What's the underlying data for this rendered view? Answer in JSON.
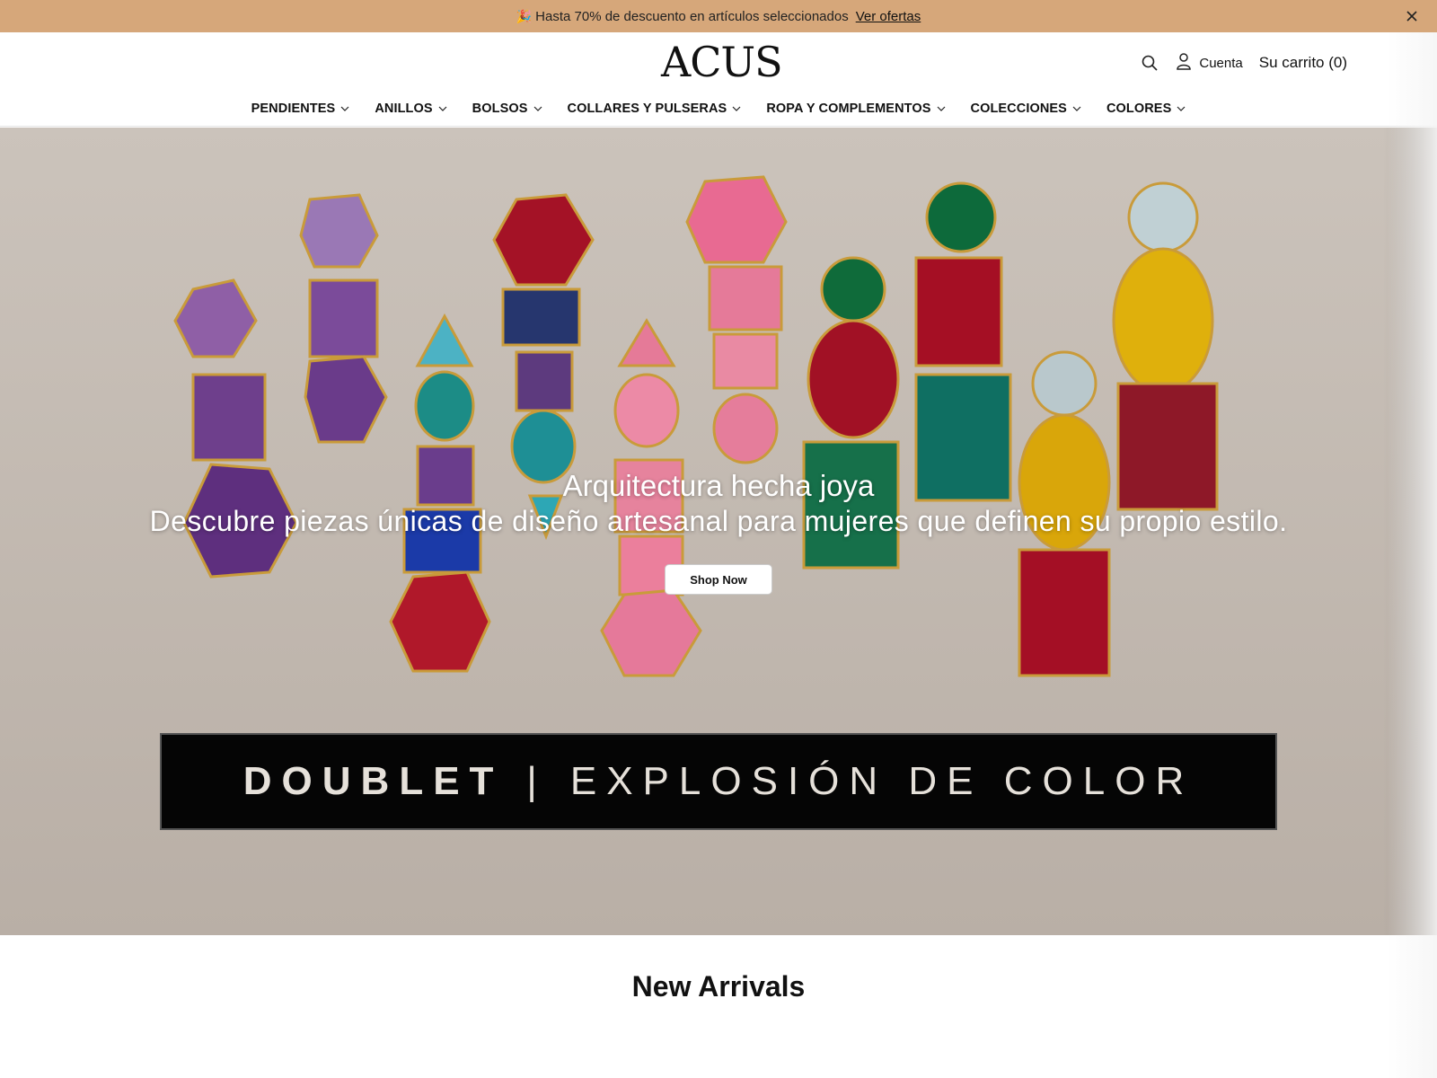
{
  "announcement": {
    "emoji": "🎉",
    "text": "Hasta 70% de descuento en artículos seleccionados",
    "link_label": "Ver ofertas",
    "background": "#d6a77a"
  },
  "header": {
    "logo": "ACUS",
    "account_label": "Cuenta",
    "cart_label": "Su carrito (0)"
  },
  "nav": {
    "items": [
      {
        "label": "PENDIENTES"
      },
      {
        "label": "ANILLOS"
      },
      {
        "label": "BOLSOS"
      },
      {
        "label": "COLLARES Y PULSERAS"
      },
      {
        "label": "ROPA Y COMPLEMENTOS"
      },
      {
        "label": "COLECCIONES"
      },
      {
        "label": "COLORES"
      }
    ]
  },
  "hero": {
    "title": "Arquitectura hecha joya",
    "subtitle": "Descubre piezas únicas de diseño artesanal para mujeres que definen su propio estilo.",
    "button_label": "Shop Now",
    "banner_strong": "DOUBLET",
    "banner_separator": "|",
    "banner_light": "EXPLOSIÓN DE COLOR"
  },
  "sections": {
    "new_arrivals_title": "New Arrivals"
  }
}
